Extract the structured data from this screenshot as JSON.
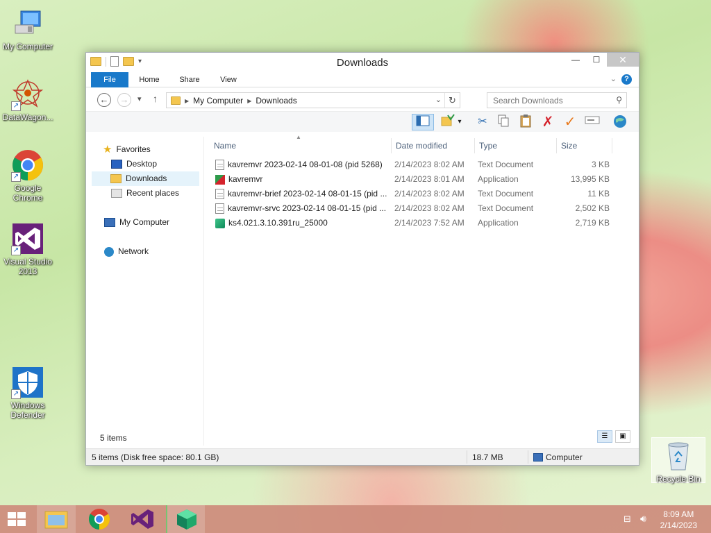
{
  "desktop": {
    "icons": [
      {
        "label": "My Computer"
      },
      {
        "label": "DataWagon..."
      },
      {
        "label": "Google Chrome"
      },
      {
        "label": "Visual Studio 2013"
      },
      {
        "label": "Windows Defender"
      }
    ],
    "recycle_bin": {
      "label": "Recycle Bin"
    }
  },
  "window": {
    "title": "Downloads",
    "ribbon_tabs": [
      "File",
      "Home",
      "Share",
      "View"
    ],
    "breadcrumb": [
      "My Computer",
      "Downloads"
    ],
    "search_placeholder": "Search Downloads"
  },
  "navpane": {
    "favorites": "Favorites",
    "desktop": "Desktop",
    "downloads": "Downloads",
    "recent": "Recent places",
    "computer": "My Computer",
    "network": "Network"
  },
  "columns": [
    "Name",
    "Date modified",
    "Type",
    "Size"
  ],
  "files": [
    {
      "name": "kavremvr 2023-02-14 08-01-08 (pid 5268)",
      "date": "2/14/2023 8:02 AM",
      "type": "Text Document",
      "size": "3 KB",
      "icon": "text-file-icon"
    },
    {
      "name": "kavremvr",
      "date": "2/14/2023 8:01 AM",
      "type": "Application",
      "size": "13,995 KB",
      "icon": "kaspersky-app-icon"
    },
    {
      "name": "kavremvr-brief 2023-02-14 08-01-15 (pid ...",
      "date": "2/14/2023 8:02 AM",
      "type": "Text Document",
      "size": "11 KB",
      "icon": "text-file-icon"
    },
    {
      "name": "kavremvr-srvc 2023-02-14 08-01-15 (pid ...",
      "date": "2/14/2023 8:02 AM",
      "type": "Text Document",
      "size": "2,502 KB",
      "icon": "text-file-icon"
    },
    {
      "name": "ks4.021.3.10.391ru_25000",
      "date": "2/14/2023 7:52 AM",
      "type": "Application",
      "size": "2,719 KB",
      "icon": "installer-app-icon"
    }
  ],
  "item_count": "5 items",
  "status": {
    "left": "5 items (Disk free space: 80.1 GB)",
    "size": "18.7 MB",
    "location": "Computer"
  },
  "taskbar": {
    "time": "8:09 AM",
    "date": "2/14/2023"
  }
}
